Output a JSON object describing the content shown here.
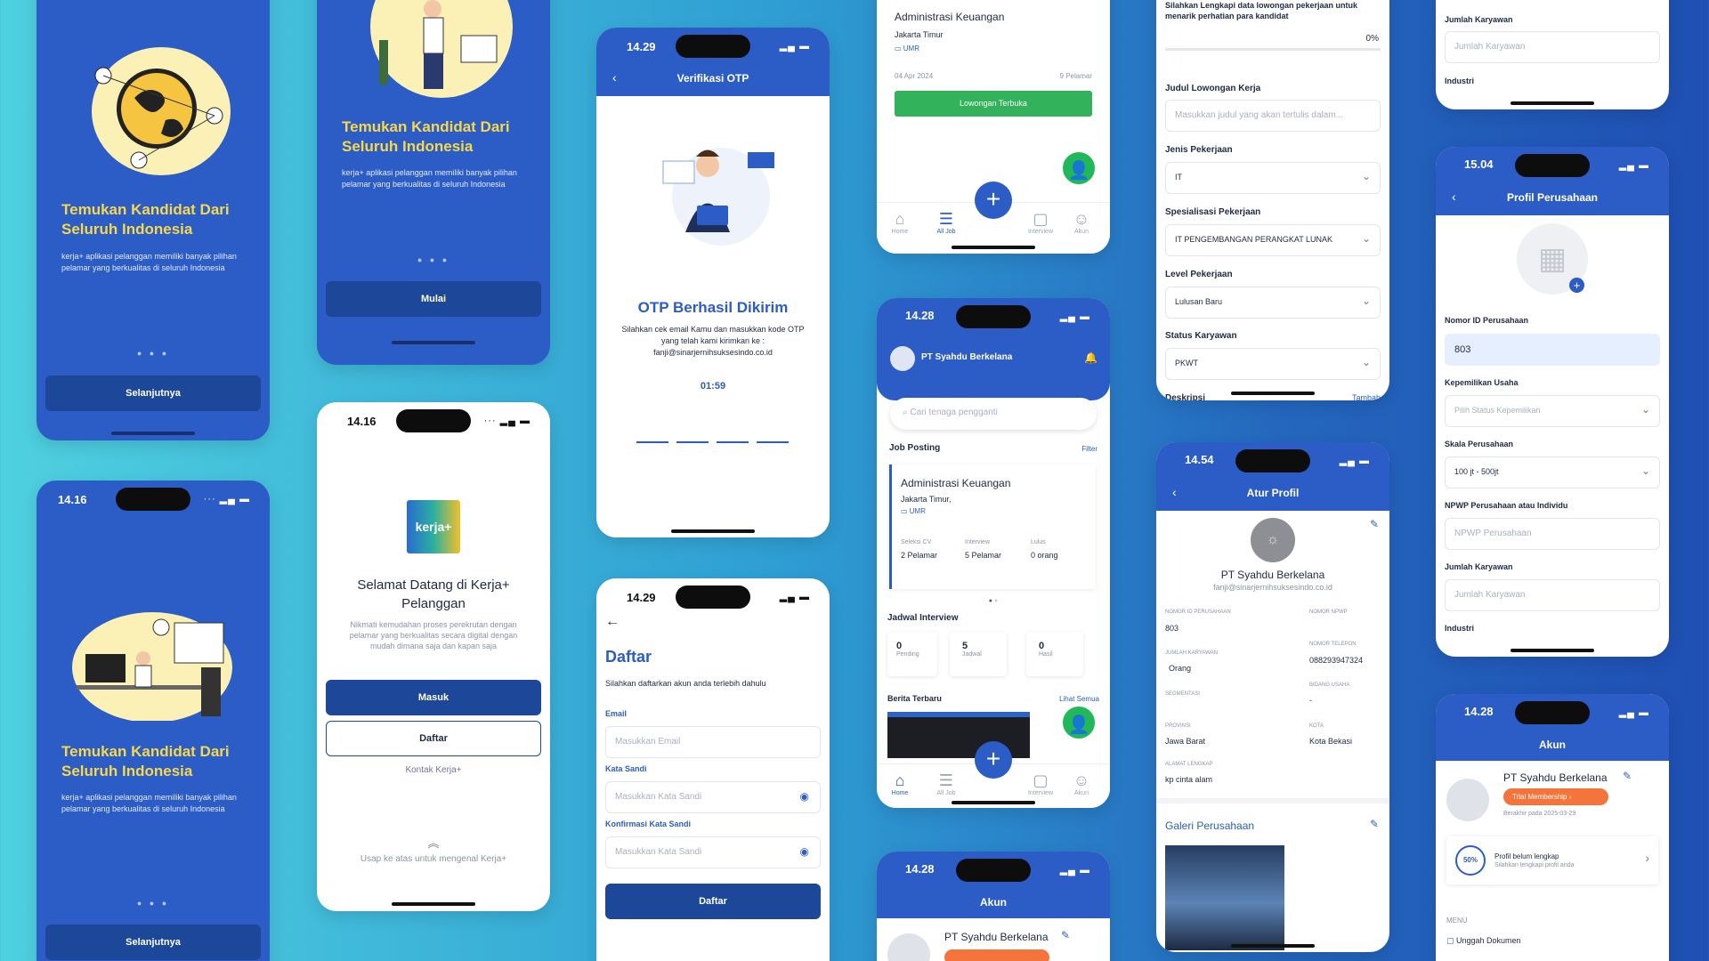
{
  "onb1": {
    "title": "Temukan Kandidat Dari Seluruh Indonesia",
    "desc": "kerja+ aplikasi pelanggan memiliki banyak pilihan pelamar yang berkualitas di seluruh Indonesia",
    "button": "Selanjutnya"
  },
  "onb2": {
    "title": "Temukan Kandidat Dari Seluruh Indonesia",
    "desc": "kerja+ aplikasi pelanggan memiliki banyak pilihan pelamar yang berkualitas di seluruh Indonesia",
    "button": "Mulai"
  },
  "onb3": {
    "time": "14.16",
    "title": "Temukan Kandidat Dari Seluruh Indonesia",
    "desc": "kerja+ aplikasi pelanggan memiliki banyak pilihan pelamar yang berkualitas di seluruh Indonesia",
    "button": "Selanjutnya"
  },
  "welcome": {
    "time": "14.16",
    "logo": "kerja+",
    "title": "Selamat Datang di Kerja+ Pelanggan",
    "desc": "Nikmati kemudahan proses perekrutan dengan pelamar yang berkualitas secara digital dengan mudah dimana saja dan kapan saja",
    "login": "Masuk",
    "register": "Daftar",
    "contact": "Kontak Kerja+",
    "swipe": "Usap ke atas untuk mengenal Kerja+"
  },
  "otp": {
    "time": "14.29",
    "title": "Verifikasi OTP",
    "heading": "OTP Berhasil Dikirim",
    "desc": "Silahkan cek email Kamu dan masukkan kode OTP yang telah kami kirimkan ke :",
    "email": "fanji@sinarjernihsuksesindo.co.id",
    "timer": "01:59"
  },
  "daftar": {
    "time": "14.29",
    "title": "Daftar",
    "desc": "Silahkan daftarkan akun anda terlebih dahulu",
    "email_label": "Email",
    "email_ph": "Masukkan Email",
    "pass_label": "Kata Sandi",
    "pass_ph": "Masukkan Kata Sandi",
    "confirm_label": "Konfirmasi Kata Sandi",
    "confirm_ph": "Masukkan Kata Sandi",
    "button": "Daftar"
  },
  "alljob": {
    "job_title": "Administrasi Keuangan",
    "location": "Jakarta Timur",
    "salary": "UMR",
    "date": "04 Apr 2024",
    "applicants": "9 Pelamar",
    "status_button": "Lowongan Terbuka",
    "nav": [
      "Home",
      "All Job",
      "Interview",
      "Akun"
    ]
  },
  "home": {
    "time": "14.28",
    "company": "PT Syahdu Berkelana",
    "search_ph": "Cari tenaga pengganti",
    "job_posting": "Job Posting",
    "filter": "Filter",
    "job_title": "Administrasi Keuangan",
    "location": "Jakarta Timur,",
    "salary": "UMR",
    "stats": [
      {
        "label": "Seleksi CV",
        "value": "2 Pelamar"
      },
      {
        "label": "Interview",
        "value": "5 Pelamar"
      },
      {
        "label": "Lulus",
        "value": "0 orang"
      }
    ],
    "schedule_title": "Jadwal Interview",
    "schedule": [
      {
        "value": "0",
        "label": "Pending"
      },
      {
        "value": "5",
        "label": "Jadwal"
      },
      {
        "value": "0",
        "label": "Hasil"
      }
    ],
    "news_title": "Berita Terbaru",
    "see_all": "Lihat Semua",
    "nav": [
      "Home",
      "All Job",
      "Interview",
      "Akun"
    ]
  },
  "akun_small": {
    "time": "14.28",
    "title": "Akun",
    "company": "PT Syahdu Berkelana"
  },
  "form": {
    "intro": "Silahkan Lengkapi data lowongan pekerjaan untuk menarik perhatian para kandidat",
    "progress": "0%",
    "job_title_label": "Judul Lowongan Kerja",
    "job_title_ph": "Masukkan judul yang akan tertulis dalam...",
    "type_label": "Jenis Pekerjaan",
    "type_val": "IT",
    "spec_label": "Spesialisasi Pekerjaan",
    "spec_val": "IT PENGEMBANGAN PERANGKAT LUNAK",
    "level_label": "Level Pekerjaan",
    "level_val": "Lulusan Baru",
    "status_label": "Status Karyawan",
    "status_val": "PKWT",
    "desc_label": "Deskripsi",
    "add": "Tambah"
  },
  "atur": {
    "time": "14.54",
    "title": "Atur Profil",
    "company": "PT Syahdu Berkelana",
    "email": "fanji@sinarjernihsuksesindo.co.id",
    "fields": [
      {
        "label": "NOMOR ID PERUSAHAAN",
        "value": "803"
      },
      {
        "label": "NOMOR NPWP",
        "value": ""
      },
      {
        "label": "JUMLAH KARYAWAN",
        "value": "Orang"
      },
      {
        "label": "NOMOR TELEPON",
        "value": "088293947324"
      },
      {
        "label": "SEGMENTASI",
        "value": ""
      },
      {
        "label": "BIDANG USAHA",
        "value": "-"
      },
      {
        "label": "PROVINSI",
        "value": "Jawa Barat"
      },
      {
        "label": "KOTA",
        "value": "Kota Bekasi"
      },
      {
        "label": "ALAMAT LENGKAP",
        "value": "kp cinta alam"
      }
    ],
    "gallery": "Galeri Perusahaan"
  },
  "top_right": {
    "emp_label": "Jumlah Karyawan",
    "emp_ph": "Jumlah Karyawan",
    "industry_label": "Industri"
  },
  "profil": {
    "time": "15.04",
    "title": "Profil Perusahaan",
    "id_label": "Nomor ID Perusahaan",
    "id_val": "803",
    "owner_label": "Kepemilikan Usaha",
    "owner_ph": "Pilih Status Kepemilikan",
    "scale_label": "Skala Perusahaan",
    "scale_val": "100 jt - 500jt",
    "npwp_label": "NPWP Perusahaan atau Individu",
    "npwp_ph": "NPWP Perusahaan",
    "emp_label": "Jumlah Karyawan",
    "emp_ph": "Jumlah Karyawan",
    "industry_label": "Industri"
  },
  "akun": {
    "time": "14.28",
    "title": "Akun",
    "company": "PT Syahdu Berkelana",
    "badge": "Trial Membership",
    "expiry": "Berakhir pada 2025-03-29",
    "percent": "50%",
    "profile_title": "Profil belum lengkap",
    "profile_desc": "Silahkan lengkapi profil anda",
    "menu": "MENU",
    "upload": "Unggah Dokumen"
  }
}
